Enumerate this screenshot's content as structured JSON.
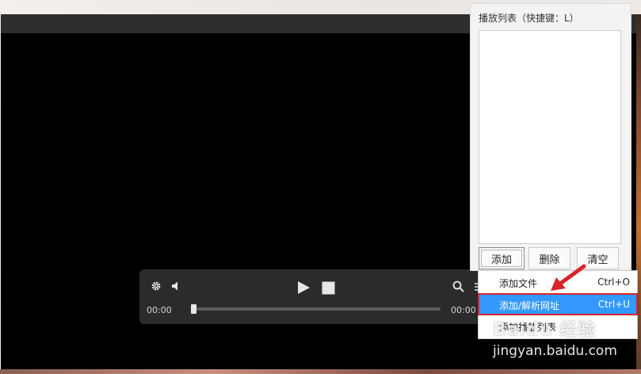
{
  "controls": {
    "time_current": "00:00",
    "time_total": "00:00",
    "progress": 0
  },
  "playlist": {
    "title": "播放列表（快捷键：L）",
    "add_label": "添加",
    "delete_label": "删除",
    "clear_label": "清空"
  },
  "menu": {
    "items": [
      {
        "label": "添加文件",
        "shortcut": "Ctrl+O"
      },
      {
        "label": "添加/解析网址",
        "shortcut": "Ctrl+U"
      },
      {
        "label": "添加播放列表",
        "shortcut": ""
      }
    ]
  },
  "watermark": {
    "logo_text": "Baidu 经验",
    "site": "jingyan.baidu.com"
  },
  "colors": {
    "highlight": "#3399ff",
    "annotation_red": "#d8232a"
  }
}
